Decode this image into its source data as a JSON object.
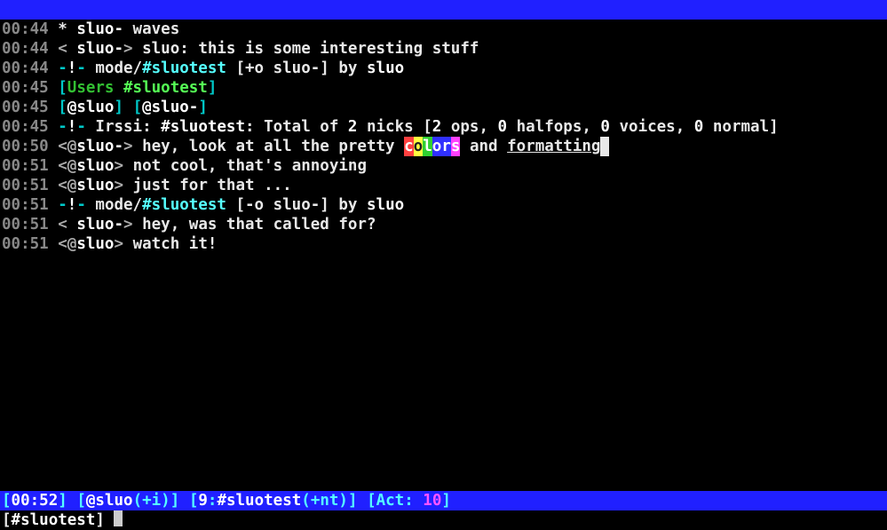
{
  "lines": [
    {
      "ts": "00:44",
      "type": "action",
      "nick": "sluo-",
      "text": "waves"
    },
    {
      "ts": "00:44",
      "type": "msg",
      "bracketL": "<",
      "bracketR": ">",
      "prefix": " ",
      "nick": "sluo-",
      "text": "sluo: this is some interesting stuff"
    },
    {
      "ts": "00:44",
      "type": "mode",
      "modeLabel": "mode/",
      "chan": "#sluotest",
      "flags": "[+o sluo-]",
      "byLabel": "by",
      "by": "sluo"
    },
    {
      "ts": "00:45",
      "type": "users",
      "label": "Users",
      "chan": "#sluotest"
    },
    {
      "ts": "00:45",
      "type": "nicklist",
      "nicks": [
        "@sluo",
        "@sluo-"
      ]
    },
    {
      "ts": "00:45",
      "type": "irssi",
      "irssi": "Irssi:",
      "chan": "#sluotest",
      "pre": ": Total of ",
      "count": "2",
      "mid": " nicks  [",
      "ops": "2",
      "opsL": " ops, ",
      "hops": "0",
      "hopsL": " halfops, ",
      "voices": "0",
      "voicesL": " voices, ",
      "normal": "0",
      "normalL": " normal]"
    },
    {
      "ts": "00:50",
      "type": "colors",
      "bracketL": "<",
      "bracketR": ">",
      "prefix": "@",
      "nick": "sluo-",
      "lead": "hey, look at all the pretty ",
      "and": " and ",
      "fmt": "formatting"
    },
    {
      "ts": "00:51",
      "type": "msg",
      "bracketL": "<",
      "bracketR": ">",
      "prefix": "@",
      "nick": "sluo",
      "text": "not cool, that's annoying"
    },
    {
      "ts": "00:51",
      "type": "msg",
      "bracketL": "<",
      "bracketR": ">",
      "prefix": "@",
      "nick": "sluo",
      "text": "just for that ..."
    },
    {
      "ts": "00:51",
      "type": "mode",
      "modeLabel": "mode/",
      "chan": "#sluotest",
      "flags": "[-o sluo-]",
      "byLabel": "by",
      "by": "sluo"
    },
    {
      "ts": "00:51",
      "type": "msg",
      "bracketL": "<",
      "bracketR": ">",
      "prefix": " ",
      "nick": "sluo-",
      "text": "hey, was that called for?"
    },
    {
      "ts": "00:51",
      "type": "msg",
      "bracketL": "<",
      "bracketR": ">",
      "prefix": "@",
      "nick": "sluo",
      "text": "watch it!"
    }
  ],
  "color_word": [
    "c",
    "o",
    "l",
    "o",
    "r",
    "s"
  ],
  "status": {
    "open": "[",
    "close": "]",
    "time": "00:52",
    "nick": "@sluo",
    "modeParen": "(+i)",
    "winNo": "9",
    "colon": ":",
    "chan": "#sluotest",
    "chanModes": "(+nt)",
    "actLabel": "Act: ",
    "act": "10"
  },
  "input": {
    "open": "[",
    "close": "]",
    "chan": "#sluotest"
  }
}
